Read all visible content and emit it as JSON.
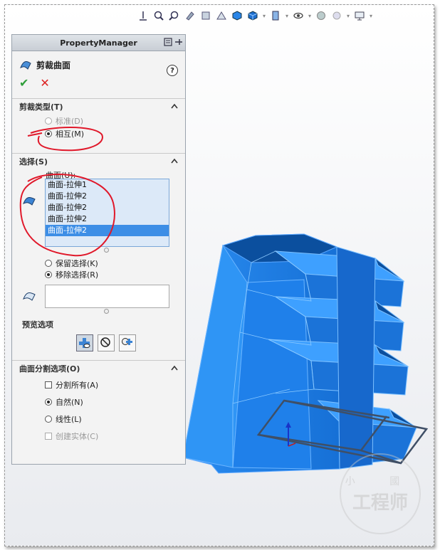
{
  "property_manager": {
    "title": "PropertyManager",
    "feature_name": "剪裁曲面",
    "help_label": "?",
    "ok_label": "✔",
    "cancel_label": "✕"
  },
  "trim_type": {
    "header": "剪裁类型(T)",
    "options": [
      {
        "label": "标准(D)",
        "selected": false,
        "enabled": false
      },
      {
        "label": "相互(M)",
        "selected": true,
        "enabled": true
      }
    ]
  },
  "selection": {
    "header": "选择(S)",
    "surfaces_label": "曲面(U):",
    "surfaces": [
      "曲面-拉伸1",
      "曲面-拉伸2",
      "曲面-拉伸2",
      "曲面-拉伸2",
      "曲面-拉伸2"
    ],
    "selected_index": 4,
    "keep_label": "保留选择(K)",
    "remove_label": "移除选择(R)",
    "keep_selected": false,
    "remove_selected": true
  },
  "preview": {
    "header": "预览选项",
    "buttons": [
      "show-included-icon",
      "show-excluded-icon",
      "show-all-icon"
    ]
  },
  "split": {
    "header": "曲面分割选项(O)",
    "split_all_label": "分割所有(A)",
    "natural_label": "自然(N)",
    "linear_label": "线性(L)",
    "create_solid_label": "创建实体(C)",
    "natural_selected": true
  },
  "watermark": {
    "line1": "小 國",
    "line2": "工程师"
  },
  "colors": {
    "model_blue": "#1e7fe6",
    "model_dark": "#0a4a9a",
    "annotation_red": "#e0182a",
    "selection_blue": "#3d8ee6"
  }
}
